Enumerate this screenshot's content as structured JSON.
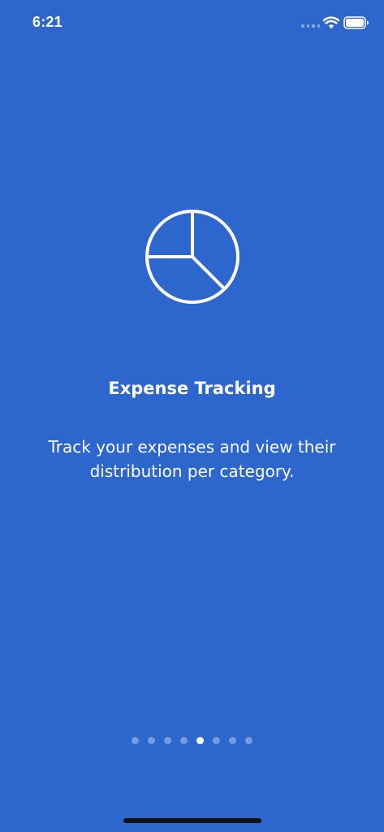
{
  "status_bar": {
    "time": "6:21",
    "wifi_icon": "wifi-icon",
    "battery_icon": "battery-icon"
  },
  "onboarding": {
    "icon": "pie-chart-icon",
    "title": "Expense Tracking",
    "description": "Track your expenses and view their distribution per category."
  },
  "pagination": {
    "total_pages": 8,
    "current_page": 5
  },
  "colors": {
    "background": "#2d66cc",
    "foreground": "#ffffff"
  }
}
